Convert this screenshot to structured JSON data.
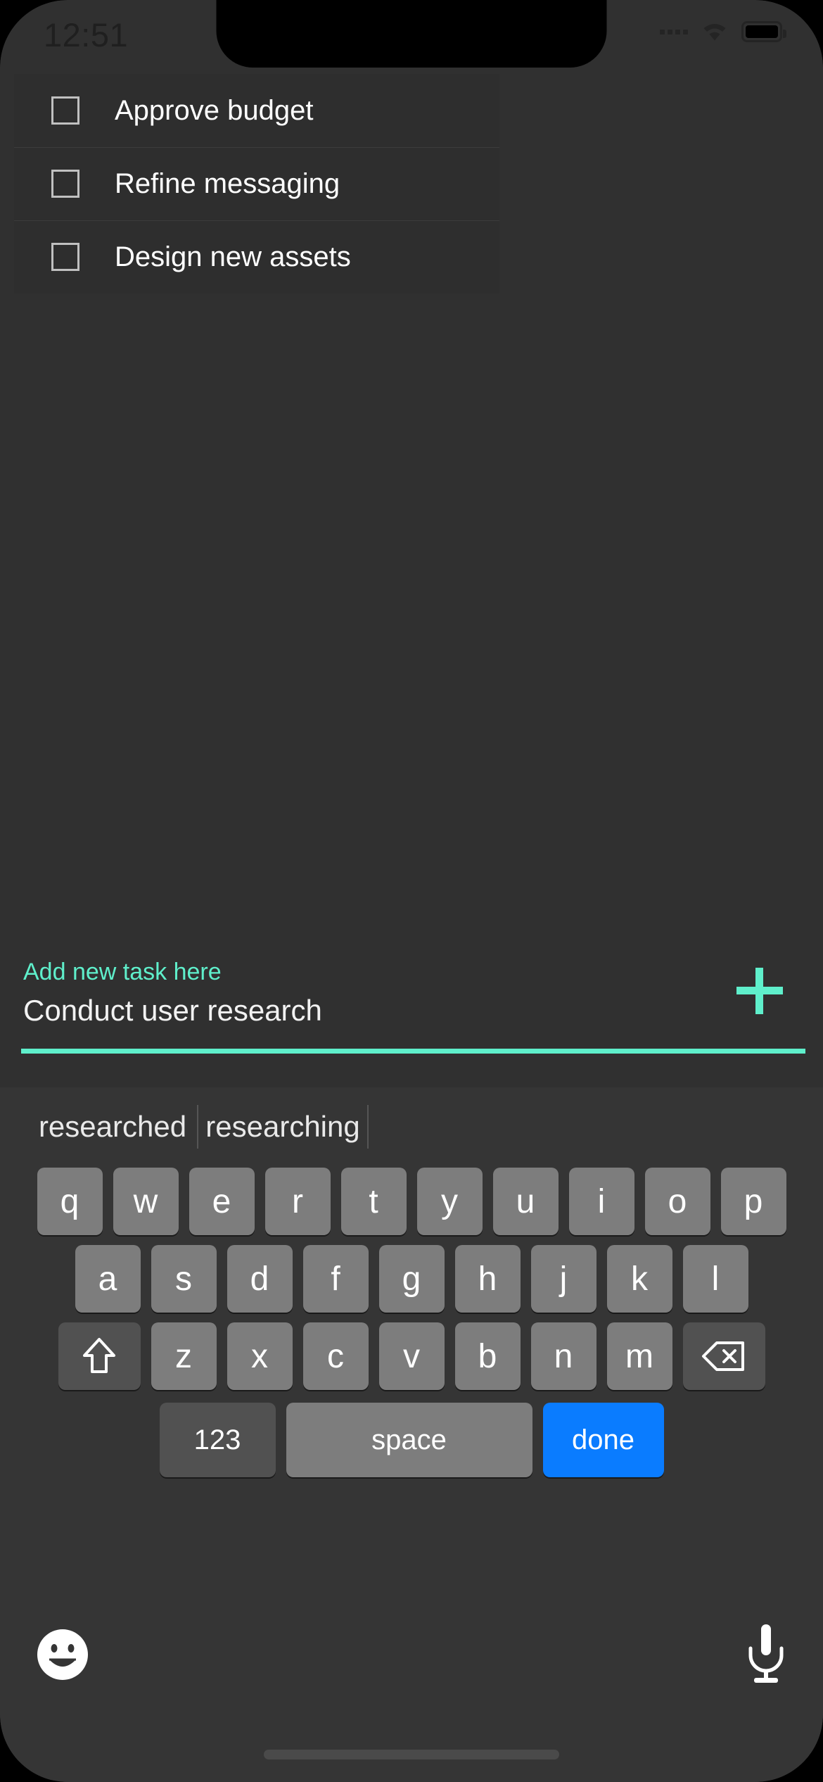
{
  "status_bar": {
    "time": "12:51",
    "icons": [
      "signal-dots-icon",
      "wifi-icon",
      "battery-icon"
    ]
  },
  "task_list": {
    "tasks": [
      {
        "label": "Approve budget",
        "checked": false
      },
      {
        "label": "Refine messaging",
        "checked": false
      },
      {
        "label": "Design new assets",
        "checked": false
      }
    ]
  },
  "input_area": {
    "label": "Add new task here",
    "value": "Conduct user research",
    "add_button_icon": "plus-icon",
    "accent_color": "#5FEFCB"
  },
  "keyboard": {
    "suggestions": [
      "researched",
      "researching"
    ],
    "row1": [
      "q",
      "w",
      "e",
      "r",
      "t",
      "y",
      "u",
      "i",
      "o",
      "p"
    ],
    "row2": [
      "a",
      "s",
      "d",
      "f",
      "g",
      "h",
      "j",
      "k",
      "l"
    ],
    "row3": [
      "z",
      "x",
      "c",
      "v",
      "b",
      "n",
      "m"
    ],
    "shift_label": "shift-icon",
    "backspace_label": "backspace-icon",
    "numeric_label": "123",
    "space_label": "space",
    "return_label": "done",
    "emoji_icon": "emoji-smiley-icon",
    "mic_icon": "microphone-icon",
    "key_color": "#7d7d7d",
    "modifier_color": "#515151",
    "return_color": "#0a7cff"
  }
}
